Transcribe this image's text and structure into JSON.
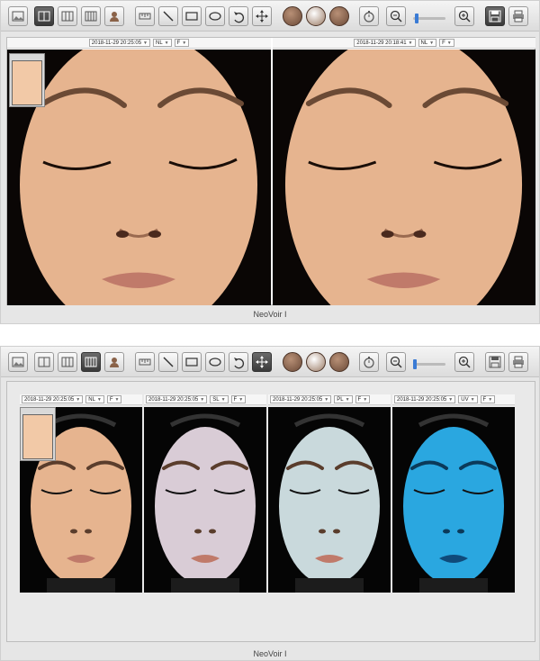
{
  "app": {
    "name": "NeoVoir I"
  },
  "top_window": {
    "panes": [
      {
        "timestamp": "2018-11-29 20:25:05",
        "mode": "NL",
        "light": "F",
        "skin": "natural"
      },
      {
        "timestamp": "2018-11-29 20:18:41",
        "mode": "NL",
        "light": "F",
        "skin": "natural"
      }
    ]
  },
  "bottom_window": {
    "panes": [
      {
        "timestamp": "2018-11-29 20:25:05",
        "mode": "NL",
        "light": "F",
        "skin": "natural"
      },
      {
        "timestamp": "2018-11-29 20:25:05",
        "mode": "SL",
        "light": "F",
        "skin": "pale"
      },
      {
        "timestamp": "2018-11-29 20:25:05",
        "mode": "PL",
        "light": "F",
        "skin": "cool"
      },
      {
        "timestamp": "2018-11-29 20:25:05",
        "mode": "UV",
        "light": "F",
        "skin": "uv"
      }
    ]
  },
  "colors": {
    "natural": "#e6b48f",
    "pale": "#d9ccd6",
    "cool": "#c9d9dc",
    "uv": "#2aa7e0",
    "accent": "#3a7bd5"
  },
  "icons": [
    "image-icon",
    "layout-2-icon",
    "layout-3-icon",
    "layout-4-icon",
    "user-icon",
    "ruler-icon",
    "line-tool-icon",
    "rectangle-tool-icon",
    "ellipse-tool-icon",
    "undo-icon",
    "move-icon",
    "face-left-icon",
    "face-front-icon",
    "face-right-icon",
    "timer-icon",
    "zoom-out-icon",
    "zoom-in-icon",
    "save-icon",
    "print-icon"
  ]
}
